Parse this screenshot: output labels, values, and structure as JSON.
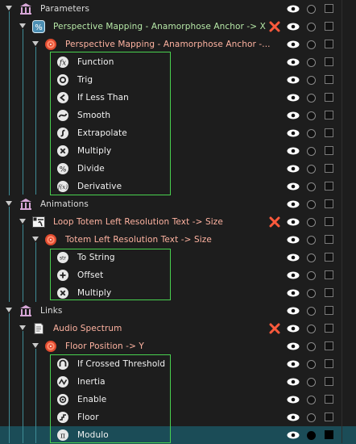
{
  "rows": [
    {
      "label": "Parameters",
      "color": "parent"
    },
    {
      "label": "Perspective  Mapping - Anamorphose Anchor -> X",
      "color": "green",
      "x_mark": true
    },
    {
      "label": "Perspective  Mapping - Anamorphose Anchor -...",
      "color": "pink"
    },
    {
      "label": "Function",
      "color": "white"
    },
    {
      "label": "Trig",
      "color": "white"
    },
    {
      "label": "If Less Than",
      "color": "white"
    },
    {
      "label": "Smooth",
      "color": "white"
    },
    {
      "label": "Extrapolate",
      "color": "white"
    },
    {
      "label": "Multiply",
      "color": "white"
    },
    {
      "label": "Divide",
      "color": "white"
    },
    {
      "label": "Derivative",
      "color": "white"
    },
    {
      "label": "Animations",
      "color": "parent"
    },
    {
      "label": "Loop Totem Left Resolution Text -> Size",
      "color": "pink",
      "x_mark": true
    },
    {
      "label": "Totem Left Resolution Text -> Size",
      "color": "pink"
    },
    {
      "label": "To String",
      "color": "white"
    },
    {
      "label": "Offset",
      "color": "white"
    },
    {
      "label": "Multiply",
      "color": "white"
    },
    {
      "label": "Links",
      "color": "parent"
    },
    {
      "label": "Audio Spectrum",
      "color": "pink",
      "x_mark": true
    },
    {
      "label": "Floor Position -> Y",
      "color": "pink"
    },
    {
      "label": "If Crossed Threshold",
      "color": "white"
    },
    {
      "label": "Inertia",
      "color": "white"
    },
    {
      "label": "Enable",
      "color": "white"
    },
    {
      "label": "Floor",
      "color": "white"
    },
    {
      "label": "Modulo",
      "color": "white",
      "selected": true
    }
  ],
  "colors": {
    "background": "#1d1d1d",
    "selected_row": "#1b4c57",
    "tree_line": "#3f8c96",
    "group_border": "#49d14f",
    "remove_x": "#ff5a3c",
    "label_green": "#b6e8a7",
    "label_pink": "#ffb3a1"
  }
}
